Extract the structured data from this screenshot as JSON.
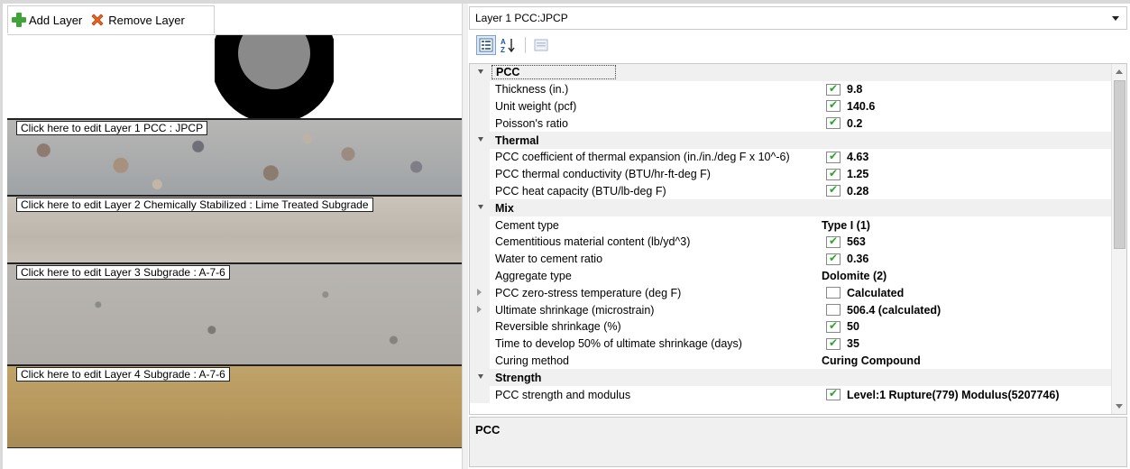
{
  "toolbar": {
    "add_layer": "Add Layer",
    "remove_layer": "Remove Layer"
  },
  "layers": [
    {
      "label": "Click here to edit Layer 1 PCC : JPCP"
    },
    {
      "label": "Click here to edit Layer 2 Chemically Stabilized : Lime Treated Subgrade"
    },
    {
      "label": "Click here to edit Layer 3 Subgrade : A-7-6"
    },
    {
      "label": "Click here to edit Layer 4 Subgrade : A-7-6"
    }
  ],
  "layer_selector": {
    "value": "Layer 1 PCC:JPCP"
  },
  "property_grid": {
    "categories": [
      {
        "name": "PCC",
        "rows": [
          {
            "name": "Thickness (in.)",
            "checked": true,
            "value": "9.8"
          },
          {
            "name": "Unit weight (pcf)",
            "checked": true,
            "value": "140.6"
          },
          {
            "name": "Poisson's ratio",
            "checked": true,
            "value": "0.2"
          }
        ]
      },
      {
        "name": "Thermal",
        "rows": [
          {
            "name": "PCC coefficient of thermal expansion (in./in./deg F x 10^-6)",
            "checked": true,
            "value": "4.63"
          },
          {
            "name": "PCC thermal conductivity (BTU/hr-ft-deg F)",
            "checked": true,
            "value": "1.25"
          },
          {
            "name": "PCC heat capacity (BTU/lb-deg F)",
            "checked": true,
            "value": "0.28"
          }
        ]
      },
      {
        "name": "Mix",
        "rows": [
          {
            "name": "Cement type",
            "value": "Type I (1)"
          },
          {
            "name": "Cementitious material content (lb/yd^3)",
            "checked": true,
            "value": "563"
          },
          {
            "name": "Water to cement ratio",
            "checked": true,
            "value": "0.36"
          },
          {
            "name": "Aggregate type",
            "value": "Dolomite (2)"
          },
          {
            "name": "PCC zero-stress temperature (deg F)",
            "checked": false,
            "value": "Calculated",
            "expandable": true
          },
          {
            "name": "Ultimate shrinkage (microstrain)",
            "checked": false,
            "value": "506.4 (calculated)",
            "expandable": true
          },
          {
            "name": "Reversible shrinkage (%)",
            "checked": true,
            "value": "50"
          },
          {
            "name": "Time to develop 50% of ultimate shrinkage (days)",
            "checked": true,
            "value": "35"
          },
          {
            "name": "Curing method",
            "value": "Curing Compound"
          }
        ]
      },
      {
        "name": "Strength",
        "rows": [
          {
            "name": "PCC strength and modulus",
            "checked": true,
            "value": "Level:1 Rupture(779) Modulus(5207746)"
          }
        ]
      }
    ]
  },
  "description": {
    "title": "PCC"
  },
  "colors": {
    "check_green": "#2aa52a",
    "add_green": "#3fa33a",
    "remove_orange": "#e8641e"
  }
}
